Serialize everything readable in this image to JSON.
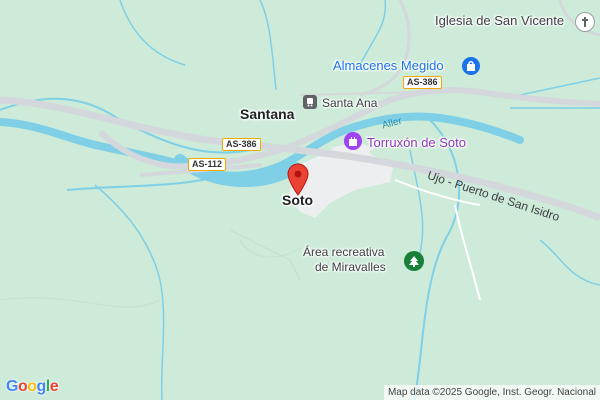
{
  "map": {
    "labels": {
      "iglesia": "Iglesia de San Vicente",
      "almacenes": "Almacenes Megido",
      "santana": "Santana",
      "santa_ana": "Santa Ana",
      "aller": "Aller",
      "torruxon": "Torruxón de Soto",
      "ujo": "Ujo - Puerto de San Isidro",
      "soto": "Soto",
      "area_line1": "Área recreativa",
      "area_line2": "de Miravalles"
    },
    "roads": {
      "as386_a": "AS-386",
      "as386_b": "AS-386",
      "as112": "AS-112"
    },
    "icons": {
      "church": "church-icon",
      "shop": "shopping-bag-icon",
      "station": "train-station-icon",
      "castle": "castle-icon",
      "park": "tree-icon",
      "pin": "location-pin-icon"
    },
    "colors": {
      "land": "#cdebd8",
      "water": "#7fd0e6",
      "road": "#d4d7db",
      "urban": "#eceef0",
      "pin": "#ea4335"
    },
    "attribution": "Map data ©2025 Google, Inst. Geogr. Nacional",
    "logo": [
      "G",
      "o",
      "o",
      "g",
      "l",
      "e"
    ]
  }
}
